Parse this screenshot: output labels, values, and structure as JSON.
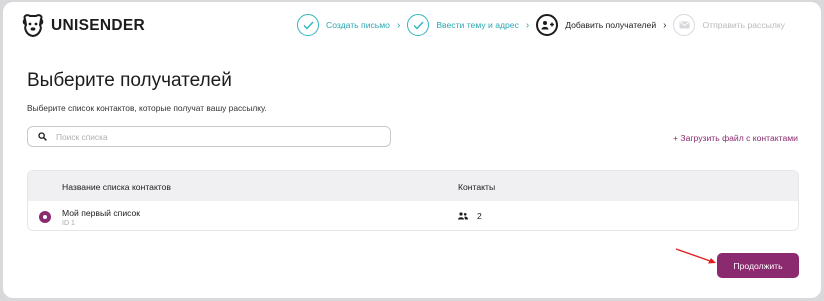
{
  "brand": {
    "name": "UNISENDER"
  },
  "steps": [
    {
      "label": "Создать письмо",
      "state": "done",
      "icon": "check-icon"
    },
    {
      "label": "Ввести тему и адрес",
      "state": "done",
      "icon": "check-icon"
    },
    {
      "label": "Добавить получателей",
      "state": "active",
      "icon": "add-user-icon"
    },
    {
      "label": "Отправить рассылку",
      "state": "pending",
      "icon": "mail-icon"
    }
  ],
  "page": {
    "title": "Выберите получателей",
    "subtitle": "Выберите список контактов, которые получат вашу рассылку."
  },
  "search": {
    "placeholder": "Поиск списка",
    "value": ""
  },
  "upload_link": "+ Загрузить файл с контактами",
  "table": {
    "columns": [
      "Название списка контактов",
      "Контакты"
    ],
    "rows": [
      {
        "name": "Мой первый список",
        "id": "ID 1",
        "contacts": "2",
        "selected": true
      }
    ]
  },
  "actions": {
    "continue_label": "Продолжить"
  },
  "colors": {
    "accent": "#8b2a6e",
    "done": "#2fb5bd",
    "annotation": "#e02020"
  }
}
